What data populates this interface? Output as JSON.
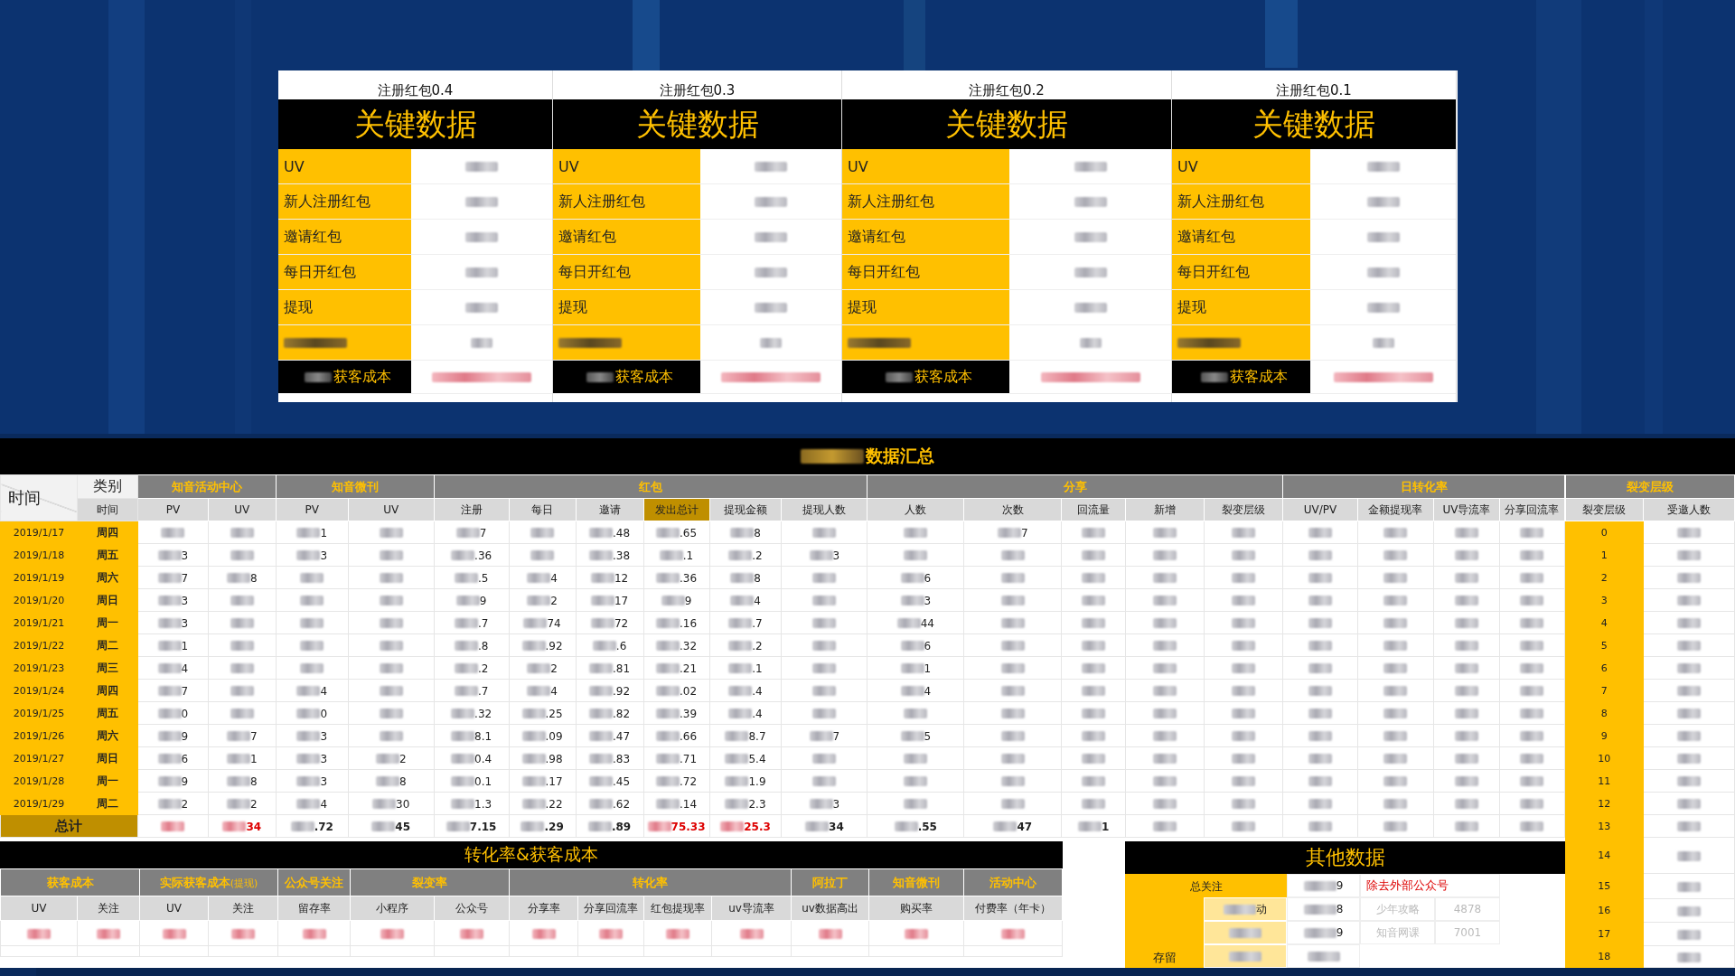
{
  "key_panels": [
    {
      "subtitle": "注册红包0.4",
      "title": "关键数据",
      "labels": [
        "UV",
        "新人注册红包",
        "邀请红包",
        "每日开红包",
        "提现"
      ],
      "cost_label": "获客成本"
    },
    {
      "subtitle": "注册红包0.3",
      "title": "关键数据",
      "labels": [
        "UV",
        "新人注册红包",
        "邀请红包",
        "每日开红包",
        "提现"
      ],
      "cost_label": "获客成本"
    },
    {
      "subtitle": "注册红包0.2",
      "title": "关键数据",
      "labels": [
        "UV",
        "新人注册红包",
        "邀请红包",
        "每日开红包",
        "提现"
      ],
      "cost_label": "获客成本"
    },
    {
      "subtitle": "注册红包0.1",
      "title": "关键数据",
      "labels": [
        "UV",
        "新人注册红包",
        "邀请红包",
        "每日开红包",
        "提现"
      ],
      "cost_label": "获客成本"
    }
  ],
  "summary_title": "数据汇总",
  "corner": {
    "category": "类别",
    "time": "时间",
    "time_sub": "时间"
  },
  "groups": [
    {
      "label": "知音活动中心"
    },
    {
      "label": "知音微刊"
    },
    {
      "label": "红包"
    },
    {
      "label": "分享"
    },
    {
      "label": "日转化率"
    }
  ],
  "columns": [
    {
      "label": "PV",
      "highlighted": false
    },
    {
      "label": "UV",
      "highlighted": false
    },
    {
      "label": "PV",
      "highlighted": false
    },
    {
      "label": "UV",
      "highlighted": false
    },
    {
      "label": "注册",
      "highlighted": false
    },
    {
      "label": "每日",
      "highlighted": false
    },
    {
      "label": "邀请",
      "highlighted": false
    },
    {
      "label": "发出总计",
      "highlighted": true
    },
    {
      "label": "提现金额",
      "highlighted": false
    },
    {
      "label": "提现人数",
      "highlighted": false
    },
    {
      "label": "人数",
      "highlighted": false
    },
    {
      "label": "次数",
      "highlighted": false
    },
    {
      "label": "回流量",
      "highlighted": false
    },
    {
      "label": "新增",
      "highlighted": false
    },
    {
      "label": "裂变层级",
      "highlighted": false
    },
    {
      "label": "UV/PV",
      "highlighted": false
    },
    {
      "label": "金额提现率",
      "highlighted": false
    },
    {
      "label": "UV导流率",
      "highlighted": false
    },
    {
      "label": "分享回流率",
      "highlighted": false
    }
  ],
  "rows": [
    {
      "date": "2019/1/17",
      "weekday": "周四",
      "cells": [
        null,
        null,
        "1",
        null,
        "7",
        null,
        ".48",
        ".65",
        "8",
        null,
        null,
        "7",
        null,
        null,
        null,
        null,
        null,
        null,
        null
      ]
    },
    {
      "date": "2019/1/18",
      "weekday": "周五",
      "cells": [
        "3",
        null,
        "3",
        null,
        ".36",
        null,
        ".38",
        ".1",
        ".2",
        "3",
        null,
        null,
        null,
        null,
        null,
        null,
        null,
        null,
        null
      ]
    },
    {
      "date": "2019/1/19",
      "weekday": "周六",
      "cells": [
        "7",
        "8",
        null,
        null,
        ".5",
        "4",
        "12",
        ".36",
        "8",
        null,
        "6",
        null,
        null,
        null,
        null,
        null,
        null,
        null,
        null
      ]
    },
    {
      "date": "2019/1/20",
      "weekday": "周日",
      "cells": [
        "3",
        null,
        null,
        null,
        "9",
        "2",
        "17",
        "9",
        "4",
        null,
        "3",
        null,
        null,
        null,
        null,
        null,
        null,
        null,
        null
      ]
    },
    {
      "date": "2019/1/21",
      "weekday": "周一",
      "cells": [
        "3",
        null,
        null,
        null,
        ".7",
        "74",
        "72",
        ".16",
        ".7",
        null,
        "44",
        null,
        null,
        null,
        null,
        null,
        null,
        null,
        null
      ]
    },
    {
      "date": "2019/1/22",
      "weekday": "周二",
      "cells": [
        "1",
        null,
        null,
        null,
        ".8",
        ".92",
        ".6",
        ".32",
        ".2",
        null,
        "6",
        null,
        null,
        null,
        null,
        null,
        null,
        null,
        null
      ]
    },
    {
      "date": "2019/1/23",
      "weekday": "周三",
      "cells": [
        "4",
        null,
        null,
        null,
        ".2",
        "2",
        ".81",
        ".21",
        ".1",
        null,
        "1",
        null,
        null,
        null,
        null,
        null,
        null,
        null,
        null
      ]
    },
    {
      "date": "2019/1/24",
      "weekday": "周四",
      "cells": [
        "7",
        null,
        "4",
        null,
        ".7",
        "4",
        ".92",
        ".02",
        ".4",
        null,
        "4",
        null,
        null,
        null,
        null,
        null,
        null,
        null,
        null
      ]
    },
    {
      "date": "2019/1/25",
      "weekday": "周五",
      "cells": [
        "0",
        null,
        "0",
        null,
        ".32",
        ".25",
        ".82",
        ".39",
        ".4",
        null,
        null,
        null,
        null,
        null,
        null,
        null,
        null,
        null,
        null
      ]
    },
    {
      "date": "2019/1/26",
      "weekday": "周六",
      "cells": [
        "9",
        "7",
        "3",
        null,
        "8.1",
        ".09",
        ".47",
        ".66",
        "8.7",
        "7",
        "5",
        null,
        null,
        null,
        null,
        null,
        null,
        null,
        null
      ]
    },
    {
      "date": "2019/1/27",
      "weekday": "周日",
      "cells": [
        "6",
        "1",
        "3",
        "2",
        "0.4",
        ".98",
        ".83",
        ".71",
        "5.4",
        null,
        null,
        null,
        null,
        null,
        null,
        null,
        null,
        null,
        null
      ]
    },
    {
      "date": "2019/1/28",
      "weekday": "周一",
      "cells": [
        "9",
        "8",
        "3",
        "8",
        "0.1",
        ".17",
        ".45",
        ".72",
        "1.9",
        null,
        null,
        null,
        null,
        null,
        null,
        null,
        null,
        null,
        null
      ]
    },
    {
      "date": "2019/1/29",
      "weekday": "周二",
      "cells": [
        "2",
        "2",
        "4",
        "30",
        "1.3",
        ".22",
        ".62",
        ".14",
        "2.3",
        "3",
        null,
        null,
        null,
        null,
        null,
        null,
        null,
        null,
        null
      ]
    }
  ],
  "total": {
    "label": "总计",
    "cells": [
      {
        "alert": true
      },
      {
        "tail": "34",
        "alert": true
      },
      {
        "tail": ".72",
        "alert": false
      },
      {
        "tail": "45",
        "alert": false
      },
      {
        "tail": "7.15",
        "alert": false
      },
      {
        "tail": ".29",
        "alert": false
      },
      {
        "tail": ".89",
        "alert": false
      },
      {
        "tail": "75.33",
        "alert": true
      },
      {
        "tail": "25.3",
        "alert": true
      },
      {
        "tail": "34",
        "alert": false
      },
      {
        "tail": ".55",
        "alert": false
      },
      {
        "tail": "47",
        "alert": false
      },
      {
        "tail": "1",
        "alert": false
      },
      {
        "alert": false
      },
      {
        "alert": false
      },
      {
        "alert": false
      },
      {
        "alert": false
      },
      {
        "alert": false
      },
      {
        "alert": false
      }
    ]
  },
  "fission": {
    "group": "裂变层级",
    "columns": [
      "裂变层级",
      "受邀人数"
    ],
    "levels": [
      "0",
      "1",
      "2",
      "3",
      "4",
      "5",
      "6",
      "7",
      "8",
      "9",
      "10",
      "11",
      "12",
      "13",
      "14",
      "15",
      "16",
      "17",
      "18"
    ]
  },
  "conversion": {
    "title": "转化率&获客成本",
    "groups": [
      {
        "label": "获客成本"
      },
      {
        "label": "实际获客成本",
        "note": "(提现)"
      },
      {
        "label": "公众号关注"
      },
      {
        "label": "裂变率"
      },
      {
        "label": "转化率"
      },
      {
        "label": "阿拉丁"
      },
      {
        "label": "知音微刊"
      },
      {
        "label": "活动中心"
      }
    ],
    "columns": [
      "UV",
      "关注",
      "UV",
      "关注",
      "留存率",
      "小程序",
      "公众号",
      "分享率",
      "分享回流率",
      "红包提现率",
      "uv导流率",
      "uv数据高出",
      "购买率",
      "付费率（年卡）"
    ]
  },
  "other": {
    "title": "其他数据",
    "total": {
      "label": "总关注",
      "tail": "9",
      "note": "除去外部公众号"
    },
    "retention": {
      "label": "存留",
      "rows": [
        {
          "name_tail": "动",
          "value_tail": "8",
          "account": "少年攻略",
          "count": "4878"
        },
        {
          "value_tail": "9",
          "account": "知音网课",
          "count": "7001"
        }
      ]
    }
  }
}
